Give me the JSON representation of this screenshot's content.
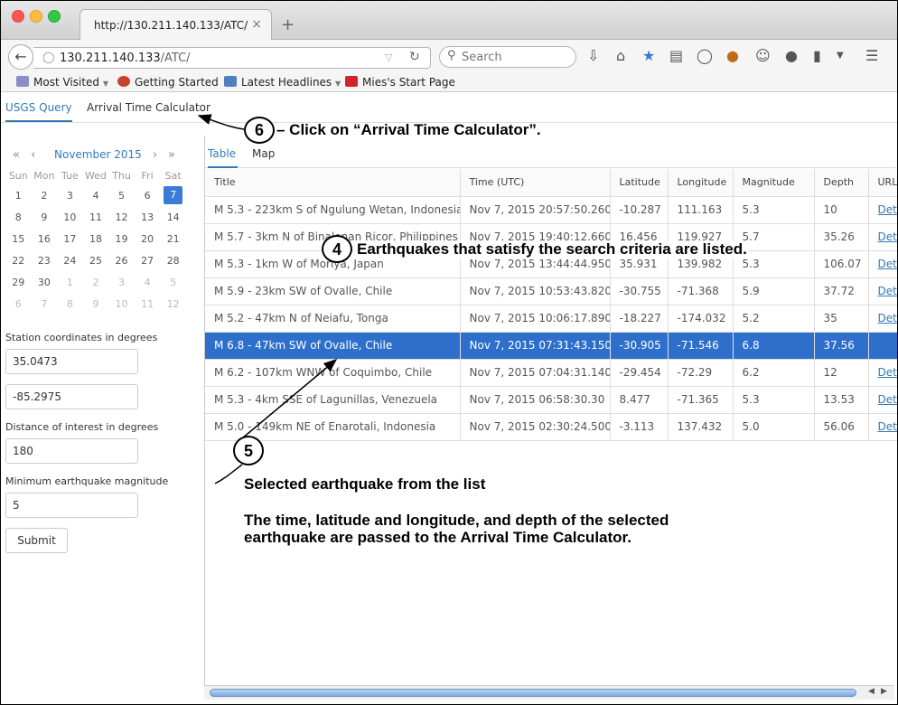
{
  "browser": {
    "tab_title": "http://130.211.140.133/ATC/",
    "tab_close": "×",
    "new_tab": "+",
    "url_host": "130.211.140.133",
    "url_path": "/ATC/",
    "search_placeholder": "Search",
    "bookmarks": [
      {
        "label": "Most Visited",
        "icon": "most-visited-icon"
      },
      {
        "label": "Getting Started",
        "icon": "firefox-icon"
      },
      {
        "label": "Latest Headlines",
        "icon": "rss-icon"
      },
      {
        "label": "Mies's Start Page",
        "icon": "xf-icon"
      }
    ],
    "colors": {
      "accent": "#3a7bd5",
      "close": "#fc5753",
      "minimize": "#fdbc40",
      "maximize": "#33c748"
    }
  },
  "app": {
    "nav": [
      "USGS Query",
      "Arrival Time Calculator"
    ],
    "calendar": {
      "prev_year": "«",
      "prev_month": "‹",
      "next_month": "›",
      "next_year": "»",
      "month": "November 2015",
      "weekdays": [
        "Sun",
        "Mon",
        "Tue",
        "Wed",
        "Thu",
        "Fri",
        "Sat"
      ],
      "weeks": [
        [
          "1",
          "2",
          "3",
          "4",
          "5",
          "6",
          "7"
        ],
        [
          "8",
          "9",
          "10",
          "11",
          "12",
          "13",
          "14"
        ],
        [
          "15",
          "16",
          "17",
          "18",
          "19",
          "20",
          "21"
        ],
        [
          "22",
          "23",
          "24",
          "25",
          "26",
          "27",
          "28"
        ],
        [
          "29",
          "30",
          "1",
          "2",
          "3",
          "4",
          "5"
        ],
        [
          "6",
          "7",
          "8",
          "9",
          "10",
          "11",
          "12"
        ]
      ],
      "selected_day": "7"
    },
    "station_label": "Station coordinates in degrees",
    "latitude_value": "35.0473",
    "longitude_value": "-85.2975",
    "distance_label": "Distance of interest in degrees",
    "distance_value": "180",
    "magnitude_label": "Minimum earthquake magnitude",
    "magnitude_value": "5",
    "submit_label": "Submit",
    "view_tabs": [
      "Table",
      "Map"
    ],
    "table": {
      "headers": [
        "Title",
        "Time (UTC)",
        "Latitude",
        "Longitude",
        "Magnitude",
        "Depth",
        "URL"
      ],
      "rows": [
        [
          "M 5.3 - 223km S of Ngulung Wetan, Indonesia",
          "Nov 7, 2015 20:57:50.260",
          "-10.287",
          "111.163",
          "5.3",
          "10",
          "Details"
        ],
        [
          "M 5.7 - 3km N of Binalonan Ricor, Philippines",
          "Nov 7, 2015 19:40:12.660",
          "16.456",
          "119.927",
          "5.7",
          "35.26",
          "Details"
        ],
        [
          "M 5.3 - 1km W of Moriya, Japan",
          "Nov 7, 2015 13:44:44.950",
          "35.931",
          "139.982",
          "5.3",
          "106.07",
          "Details"
        ],
        [
          "M 5.9 - 23km SW of Ovalle, Chile",
          "Nov 7, 2015 10:53:43.820",
          "-30.755",
          "-71.368",
          "5.9",
          "37.72",
          "Details"
        ],
        [
          "M 5.2 - 47km N of Neiafu, Tonga",
          "Nov 7, 2015 10:06:17.890",
          "-18.227",
          "-174.032",
          "5.2",
          "35",
          "Details"
        ],
        [
          "M 6.8 - 47km SW of Ovalle, Chile",
          "Nov 7, 2015 07:31:43.150",
          "-30.905",
          "-71.546",
          "6.8",
          "37.56",
          ""
        ],
        [
          "M 6.2 - 107km WNW of Coquimbo, Chile",
          "Nov 7, 2015 07:04:31.140",
          "-29.454",
          "-72.29",
          "6.2",
          "12",
          "Details"
        ],
        [
          "M 5.3 - 4km SSE of Lagunillas, Venezuela",
          "Nov 7, 2015 06:58:30.30",
          "8.477",
          "-71.365",
          "5.3",
          "13.53",
          "Details"
        ],
        [
          "M 5.0 - 149km NE of Enarotali, Indonesia",
          "Nov 7, 2015 02:30:24.500",
          "-3.113",
          "137.432",
          "5.0",
          "56.06",
          "Details"
        ]
      ],
      "selected_row": 5
    }
  },
  "annotations": {
    "step6_number": "6",
    "step6_text": "– Click on “Arrival Time Calculator”.",
    "step4_number": "4",
    "step4_text": "Earthquakes that satisfy the search criteria are listed.",
    "step5_number": "5",
    "step5_text": "Selected earthquake from the list",
    "step5_detail_line1": "The time, latitude and longitude, and depth of the selected",
    "step5_detail_line2": "earthquake are passed to the Arrival Time Calculator."
  }
}
